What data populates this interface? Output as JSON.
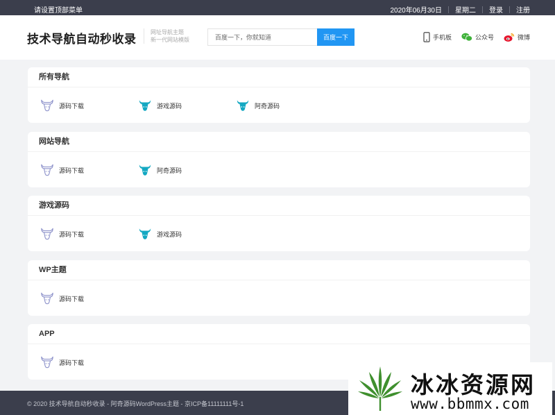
{
  "topbar": {
    "menu_text": "请设置顶部菜单",
    "date": "2020年06月30日",
    "weekday": "星期二",
    "login": "登录",
    "register": "注册"
  },
  "header": {
    "site_title": "技术导航自动秒收录",
    "tagline_1": "网址导航主题",
    "tagline_2": "新一代网站模版",
    "search_placeholder": "百度一下，你就知道",
    "search_button": "百度一下",
    "links": {
      "mobile": "手机板",
      "wechat": "公众号",
      "weibo": "微博"
    }
  },
  "colors": {
    "topbar": "#3b3e4c",
    "accent": "#2196f3",
    "bull_outline": "#8a8fc9",
    "bull_solid": "#14a8c2"
  },
  "sections": [
    {
      "title": "所有导航",
      "items": [
        {
          "label": "源码下载",
          "icon": "bull-outline-icon"
        },
        {
          "label": "游戏源码",
          "icon": "bull-solid-icon"
        },
        {
          "label": "阿奇源码",
          "icon": "bull-solid-icon"
        }
      ]
    },
    {
      "title": "网站导航",
      "items": [
        {
          "label": "源码下载",
          "icon": "bull-outline-icon"
        },
        {
          "label": "阿奇源码",
          "icon": "bull-solid-icon"
        }
      ]
    },
    {
      "title": "游戏源码",
      "items": [
        {
          "label": "源码下载",
          "icon": "bull-outline-icon"
        },
        {
          "label": "游戏源码",
          "icon": "bull-solid-icon"
        }
      ]
    },
    {
      "title": "WP主题",
      "items": [
        {
          "label": "源码下载",
          "icon": "bull-outline-icon"
        }
      ]
    },
    {
      "title": "APP",
      "items": [
        {
          "label": "源码下载",
          "icon": "bull-outline-icon"
        }
      ]
    }
  ],
  "footer": {
    "copyright": "© 2020 技术导航自动秒收录 - 阿奇源码WordPress主题 - 京ICP备11111111号-1"
  },
  "watermark": {
    "name": "冰冰资源网",
    "url": "www.bbmmx.com"
  }
}
